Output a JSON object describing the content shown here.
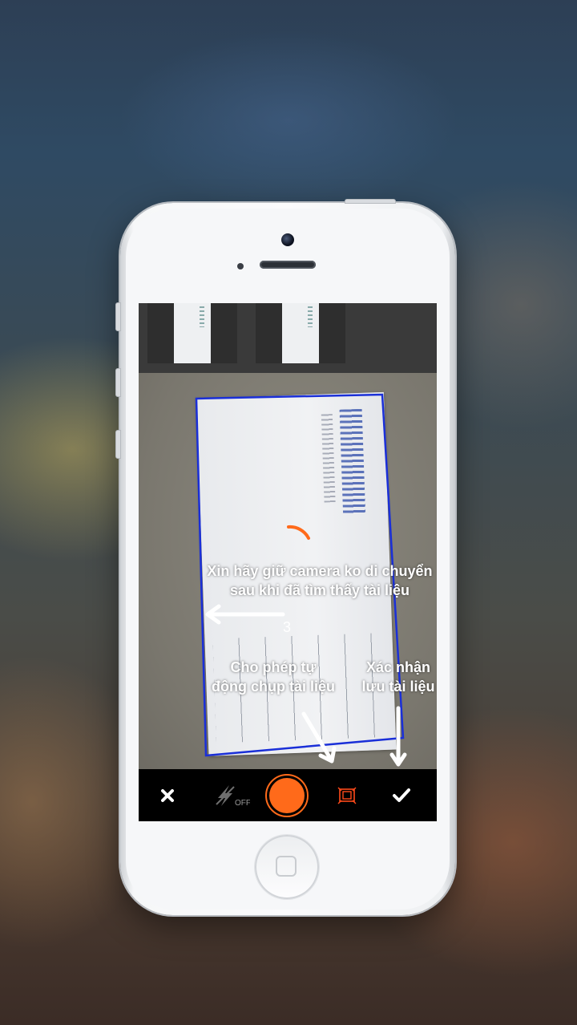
{
  "screen": {
    "countdown": "3",
    "hints": {
      "hold_steady_line1": "Xin hãy giữ camera ko di chuyển",
      "hold_steady_line2": "sau khi đã tìm thấy tài liệu",
      "auto_capture_line1": "Cho phép tự",
      "auto_capture_line2": "động chụp tài liệu",
      "confirm_line1": "Xác nhận",
      "confirm_line2": "lưu tài liệu"
    },
    "toolbar": {
      "flash_state": "OFF"
    }
  },
  "colors": {
    "accent": "#ff6a1a",
    "detect_frame": "#1a2fd8",
    "toolbar_bg": "#000000"
  },
  "icons": {
    "close": "close-icon",
    "flash": "flash-off-icon",
    "shutter": "shutter-icon",
    "auto_capture": "auto-capture-icon",
    "confirm": "checkmark-icon"
  }
}
